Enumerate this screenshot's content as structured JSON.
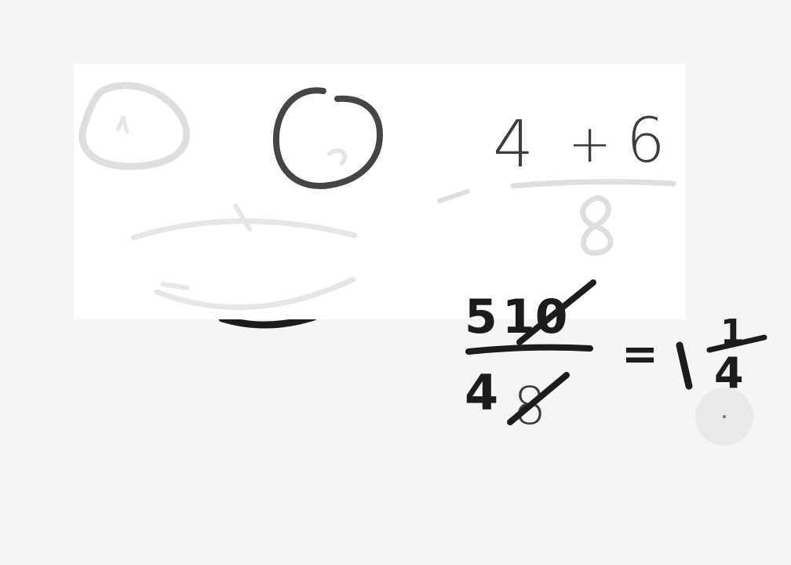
{
  "canvas": {
    "background": "#f5f5f5",
    "panel_color": "#ffffff",
    "ink_color": "#1c1c1c",
    "faded_ink_color": "#454545",
    "ghost_ink_color": "#dedede",
    "cursor_color": "#e4e4e4"
  },
  "expressions": {
    "top_sum": {
      "left": "4",
      "operator": "+",
      "right": "6"
    },
    "fraction": {
      "numerator_digit": "5",
      "numerator_crossed": "10",
      "denominator_digit": "4",
      "denominator_crossed": "8"
    },
    "equals": "=",
    "mixed_number": {
      "whole": "1",
      "numerator": "1",
      "denominator": "4"
    }
  },
  "icons": {
    "cursor": "pen-cursor-icon"
  }
}
